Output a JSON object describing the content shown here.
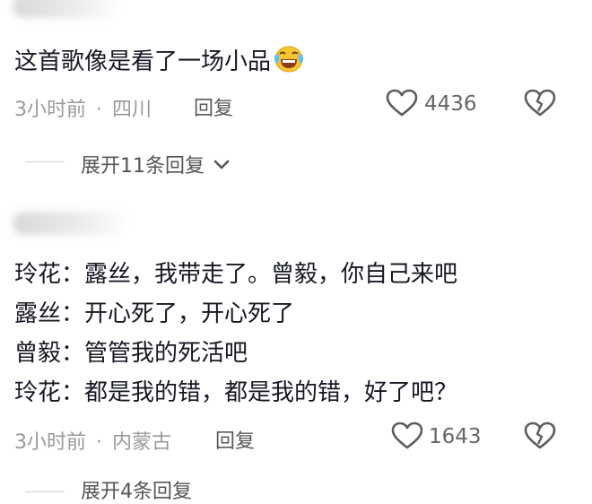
{
  "comment1": {
    "text": "这首歌像是看了一场小品",
    "emoji": "laughing-crying-emoji",
    "time": "3小时前",
    "location": "四川",
    "reply_label": "回复",
    "likes": "4436"
  },
  "expand1": {
    "label": "展开11条回复"
  },
  "comment2": {
    "lines": [
      "玲花：露丝，我带走了。曾毅，你自己来吧",
      "露丝：开心死了，开心死了",
      "曾毅：管管我的死活吧",
      "玲花：都是我的错，都是我的错，好了吧？"
    ],
    "time": "3小时前",
    "location": "内蒙古",
    "reply_label": "回复",
    "likes": "1643"
  },
  "expand2": {
    "label": "展开4条回复"
  },
  "separator": "·",
  "colors": {
    "text": "#161823",
    "meta": "#9a9a9a",
    "icon": "#5c5c5c",
    "emoji_face": "#f7c531"
  }
}
